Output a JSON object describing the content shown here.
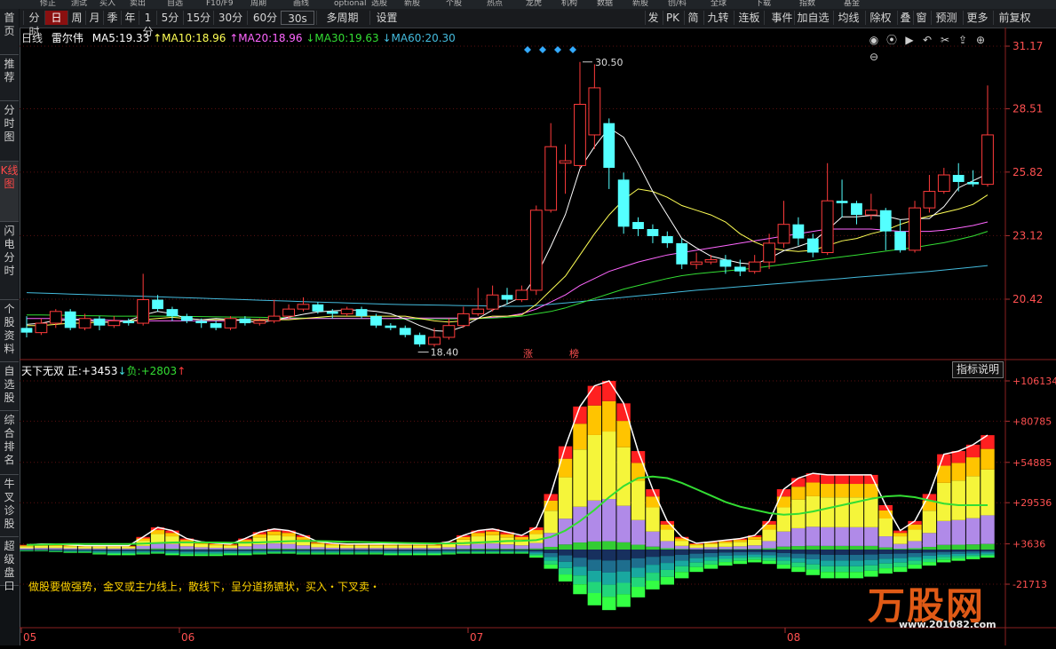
{
  "topstrip": {
    "tabs": [
      "修正",
      "测试",
      "买入",
      "卖出",
      "自选",
      "F10/F9",
      "周期",
      "画线",
      "optional",
      "选股",
      "新股",
      "个股",
      "热点",
      "龙虎",
      "机构",
      "数据",
      "新股",
      "创/科",
      "全球",
      "下载",
      "指数",
      "基金"
    ]
  },
  "leftnav": {
    "items": [
      "首页",
      "推荐",
      "分时图",
      "K线图",
      "闪电分时",
      "个股资料",
      "自选股",
      "综合排名",
      "牛叉诊股",
      "超级盘口"
    ]
  },
  "toolbar": {
    "left": [
      "分时",
      "日",
      "周",
      "月",
      "季",
      "年",
      "1分",
      "5分",
      "15分",
      "30分",
      "60分",
      "30s",
      "多周期",
      "设置"
    ],
    "right": [
      "发",
      "PK",
      "简",
      "九转",
      "连板",
      "事件",
      "加自选",
      "均线",
      "除权",
      "叠",
      "窗",
      "预测",
      "更多",
      "前复权"
    ]
  },
  "info": {
    "period": "日线",
    "stock": "雷尔伟",
    "ma5_label": "MA5:",
    "ma5": "19.33",
    "ma10_label": "↑MA10:",
    "ma10": "18.96",
    "ma20_label": "↑MA20:",
    "ma20": "18.96",
    "ma30_label": "↓MA30:",
    "ma30": "19.63",
    "ma60_label": "↓MA60:",
    "ma60": "20.30"
  },
  "indicator": {
    "name": "天下无双",
    "pos_label": "正:",
    "pos": "+3453",
    "neg_label": "负:",
    "neg": "+2803",
    "explain_button": "指标说明",
    "description": "做股要做强势，金叉或主力线上，散线下，呈分道扬镳状，买入・下叉卖・"
  },
  "price_axis": [
    "31.17",
    "28.51",
    "25.82",
    "23.12",
    "20.42"
  ],
  "indicator_axis": [
    "+106134",
    "+80785",
    "+54885",
    "+29536",
    "+3636",
    "-21713"
  ],
  "x_axis": [
    "05",
    "06",
    "07",
    "08"
  ],
  "annotations": {
    "high": "30.50",
    "low": "18.40",
    "tag1": "涨",
    "tag2": "榜"
  },
  "watermark": {
    "brand": "万股网",
    "url": "www.201082.com"
  },
  "colors": {
    "up": "#ff3b3b",
    "down": "#54ffff",
    "ma5": "#ffffff",
    "ma10": "#ffff55",
    "ma20": "#ff66ff",
    "ma30": "#33dd33",
    "ma60": "#44bbdd"
  },
  "chart_data": {
    "type": "candlestick",
    "candles": [
      [
        19.2,
        19.0,
        19.7,
        18.8
      ],
      [
        19.0,
        19.4,
        19.6,
        18.9
      ],
      [
        19.4,
        19.9,
        20.0,
        19.2
      ],
      [
        19.9,
        19.2,
        20.0,
        19.1
      ],
      [
        19.2,
        19.6,
        19.8,
        19.1
      ],
      [
        19.6,
        19.3,
        19.7,
        19.1
      ],
      [
        19.3,
        19.5,
        19.7,
        19.2
      ],
      [
        19.5,
        19.4,
        19.6,
        19.3
      ],
      [
        19.4,
        20.4,
        21.5,
        19.3
      ],
      [
        20.4,
        20.0,
        20.6,
        19.9
      ],
      [
        20.0,
        19.7,
        20.1,
        19.5
      ],
      [
        19.7,
        19.5,
        19.8,
        19.4
      ],
      [
        19.5,
        19.4,
        19.6,
        19.2
      ],
      [
        19.4,
        19.2,
        19.5,
        19.1
      ],
      [
        19.2,
        19.6,
        19.7,
        19.1
      ],
      [
        19.6,
        19.4,
        19.7,
        19.3
      ],
      [
        19.4,
        19.5,
        19.6,
        19.3
      ],
      [
        19.5,
        19.7,
        20.4,
        19.4
      ],
      [
        19.7,
        20.0,
        20.2,
        19.6
      ],
      [
        20.0,
        20.2,
        20.5,
        19.9
      ],
      [
        20.2,
        19.9,
        20.3,
        19.8
      ],
      [
        19.9,
        19.8,
        20.0,
        19.6
      ],
      [
        19.8,
        20.0,
        20.1,
        19.7
      ],
      [
        20.0,
        19.7,
        20.1,
        19.6
      ],
      [
        19.7,
        19.3,
        19.8,
        19.2
      ],
      [
        19.3,
        19.2,
        19.4,
        19.1
      ],
      [
        19.2,
        18.9,
        19.3,
        18.8
      ],
      [
        18.9,
        18.5,
        19.0,
        18.4
      ],
      [
        18.5,
        18.8,
        19.2,
        18.4
      ],
      [
        18.8,
        19.3,
        19.6,
        18.7
      ],
      [
        19.3,
        19.8,
        20.1,
        19.2
      ],
      [
        19.8,
        20.0,
        20.9,
        19.7
      ],
      [
        20.0,
        20.6,
        21.0,
        19.9
      ],
      [
        20.6,
        20.4,
        20.9,
        20.2
      ],
      [
        20.4,
        20.8,
        21.0,
        20.3
      ],
      [
        20.8,
        24.2,
        24.4,
        20.6
      ],
      [
        24.2,
        26.9,
        27.9,
        24.1
      ],
      [
        26.2,
        26.3,
        27.0,
        24.9
      ],
      [
        26.1,
        28.7,
        30.5,
        26.0
      ],
      [
        27.4,
        29.4,
        30.4,
        26.8
      ],
      [
        27.9,
        26.0,
        28.1,
        25.1
      ],
      [
        25.5,
        23.5,
        25.8,
        23.2
      ],
      [
        23.7,
        23.4,
        23.9,
        23.1
      ],
      [
        23.4,
        23.1,
        23.6,
        22.8
      ],
      [
        23.1,
        22.8,
        23.3,
        22.6
      ],
      [
        22.8,
        21.9,
        23.0,
        21.7
      ],
      [
        21.9,
        22.0,
        22.4,
        21.7
      ],
      [
        22.0,
        22.1,
        22.3,
        21.9
      ],
      [
        22.1,
        21.8,
        22.3,
        21.5
      ],
      [
        21.8,
        21.6,
        22.1,
        21.4
      ],
      [
        21.6,
        22.0,
        22.3,
        21.5
      ],
      [
        22.0,
        22.8,
        23.2,
        21.7
      ],
      [
        22.8,
        23.6,
        24.6,
        22.6
      ],
      [
        23.6,
        23.0,
        23.9,
        22.7
      ],
      [
        23.0,
        22.4,
        23.2,
        22.2
      ],
      [
        22.4,
        24.6,
        26.2,
        22.3
      ],
      [
        24.6,
        24.5,
        25.5,
        23.9
      ],
      [
        24.5,
        24.0,
        24.6,
        23.6
      ],
      [
        24.0,
        24.2,
        24.9,
        23.8
      ],
      [
        24.2,
        23.3,
        24.3,
        22.5
      ],
      [
        23.3,
        22.5,
        23.8,
        22.4
      ],
      [
        22.5,
        24.3,
        24.6,
        22.4
      ],
      [
        24.3,
        25.0,
        25.7,
        24.1
      ],
      [
        25.0,
        25.7,
        26.0,
        24.9
      ],
      [
        25.7,
        25.4,
        26.2,
        25.0
      ],
      [
        25.4,
        25.3,
        25.9,
        25.2
      ],
      [
        25.3,
        27.4,
        29.5,
        25.2
      ]
    ],
    "ma5": [
      19.35,
      19.4,
      19.52,
      19.54,
      19.55,
      19.45,
      19.45,
      19.5,
      19.75,
      19.9,
      19.8,
      19.6,
      19.55,
      19.6,
      19.56,
      19.5,
      19.42,
      19.53,
      19.66,
      19.78,
      19.88,
      19.92,
      19.96,
      19.96,
      19.9,
      19.8,
      19.58,
      19.3,
      19.08,
      19.05,
      19.26,
      19.6,
      19.96,
      20.22,
      20.52,
      21.4,
      22.66,
      24.02,
      25.96,
      26.9,
      27.7,
      27.3,
      26.2,
      25.0,
      24.0,
      23.0,
      22.6,
      22.25,
      22.1,
      21.96,
      21.9,
      22.16,
      22.48,
      22.66,
      22.88,
      23.36,
      23.92,
      23.92,
      23.98,
      23.95,
      23.8,
      23.85,
      23.85,
      24.35,
      25.15,
      25.45,
      25.75
    ],
    "ma10": [
      19.3,
      19.3,
      19.35,
      19.4,
      19.4,
      19.45,
      19.45,
      19.5,
      19.55,
      19.6,
      19.65,
      19.6,
      19.55,
      19.55,
      19.55,
      19.55,
      19.55,
      19.55,
      19.55,
      19.6,
      19.65,
      19.7,
      19.7,
      19.7,
      19.7,
      19.7,
      19.7,
      19.6,
      19.5,
      19.45,
      19.5,
      19.6,
      19.7,
      19.7,
      19.75,
      20.2,
      20.8,
      21.4,
      22.3,
      23.2,
      24.0,
      24.65,
      25.1,
      25.0,
      24.75,
      24.4,
      24.2,
      24.0,
      23.7,
      23.2,
      22.85,
      22.6,
      22.5,
      22.45,
      22.5,
      22.7,
      22.9,
      23.0,
      23.2,
      23.35,
      23.6,
      23.8,
      23.95,
      24.1,
      24.25,
      24.45,
      24.85
    ],
    "ma20": [
      19.6,
      19.6,
      19.6,
      19.58,
      19.56,
      19.54,
      19.52,
      19.5,
      19.5,
      19.5,
      19.5,
      19.5,
      19.5,
      19.5,
      19.5,
      19.55,
      19.55,
      19.55,
      19.6,
      19.6,
      19.6,
      19.6,
      19.6,
      19.6,
      19.6,
      19.6,
      19.62,
      19.62,
      19.62,
      19.62,
      19.62,
      19.62,
      19.65,
      19.7,
      19.8,
      20.0,
      20.3,
      20.6,
      21.0,
      21.3,
      21.6,
      21.8,
      22.0,
      22.15,
      22.3,
      22.4,
      22.5,
      22.6,
      22.7,
      22.8,
      22.9,
      23.0,
      23.1,
      23.2,
      23.3,
      23.4,
      23.4,
      23.4,
      23.4,
      23.35,
      23.3,
      23.3,
      23.3,
      23.35,
      23.45,
      23.55,
      23.7
    ],
    "ma30": [
      19.75,
      19.75,
      19.74,
      19.73,
      19.72,
      19.71,
      19.7,
      19.7,
      19.7,
      19.7,
      19.7,
      19.69,
      19.68,
      19.67,
      19.66,
      19.66,
      19.65,
      19.64,
      19.63,
      19.62,
      19.62,
      19.61,
      19.61,
      19.6,
      19.6,
      19.59,
      19.58,
      19.58,
      19.58,
      19.58,
      19.59,
      19.6,
      19.62,
      19.65,
      19.7,
      19.8,
      19.9,
      20.05,
      20.25,
      20.45,
      20.65,
      20.85,
      21.0,
      21.15,
      21.3,
      21.42,
      21.5,
      21.56,
      21.62,
      21.68,
      21.74,
      21.82,
      21.9,
      21.98,
      22.06,
      22.14,
      22.22,
      22.3,
      22.38,
      22.46,
      22.54,
      22.62,
      22.72,
      22.82,
      22.96,
      23.1,
      23.3
    ],
    "ma60": [
      20.7,
      20.68,
      20.66,
      20.64,
      20.62,
      20.6,
      20.58,
      20.56,
      20.54,
      20.52,
      20.5,
      20.48,
      20.46,
      20.44,
      20.42,
      20.4,
      20.38,
      20.36,
      20.34,
      20.32,
      20.3,
      20.28,
      20.26,
      20.24,
      20.22,
      20.2,
      20.19,
      20.18,
      20.17,
      20.16,
      20.15,
      20.14,
      20.13,
      20.12,
      20.12,
      20.15,
      20.2,
      20.26,
      20.32,
      20.38,
      20.44,
      20.5,
      20.56,
      20.62,
      20.68,
      20.74,
      20.8,
      20.85,
      20.9,
      20.95,
      21.0,
      21.05,
      21.1,
      21.15,
      21.2,
      21.25,
      21.3,
      21.35,
      21.4,
      21.45,
      21.5,
      21.55,
      21.6,
      21.66,
      21.72,
      21.78,
      21.85
    ],
    "indicator_pos": [
      3000,
      3500,
      3500,
      3000,
      2500,
      2500,
      2500,
      2500,
      8000,
      14000,
      12000,
      7000,
      5000,
      4000,
      3500,
      7000,
      11000,
      13000,
      12000,
      9000,
      5000,
      4000,
      3500,
      3500,
      3500,
      3500,
      3500,
      3500,
      3500,
      5000,
      9000,
      12000,
      13000,
      11000,
      9000,
      14000,
      35000,
      65000,
      90000,
      103000,
      106134,
      92000,
      62000,
      38000,
      18000,
      8000,
      4000,
      5000,
      6000,
      7000,
      9000,
      18000,
      38000,
      45000,
      48000,
      47000,
      47000,
      47000,
      47000,
      28000,
      12000,
      18000,
      35000,
      60000,
      62000,
      66000,
      72000
    ],
    "indicator_neg": [
      -1000,
      -1000,
      -1500,
      -2000,
      -2000,
      -3000,
      -3500,
      -3500,
      -3000,
      -2500,
      -3500,
      -4000,
      -4000,
      -4000,
      -3500,
      -3500,
      -3000,
      -2500,
      -2500,
      -3000,
      -3000,
      -3000,
      -3000,
      -3000,
      -3000,
      -3500,
      -3500,
      -3500,
      -3500,
      -3000,
      -2500,
      -2500,
      -2500,
      -2500,
      -2500,
      -5000,
      -12000,
      -20000,
      -28000,
      -35000,
      -38000,
      -36000,
      -30000,
      -25000,
      -22000,
      -18000,
      -14000,
      -12000,
      -10000,
      -9000,
      -8000,
      -9000,
      -12000,
      -14000,
      -16000,
      -18000,
      -18000,
      -18000,
      -17000,
      -15000,
      -14000,
      -12000,
      -10000,
      -8000,
      -7000,
      -6000,
      -5000
    ],
    "indicator_line": [
      3000,
      3200,
      3400,
      3500,
      3500,
      3500,
      3500,
      3500,
      3800,
      4200,
      4500,
      4600,
      4600,
      4500,
      4400,
      4400,
      4600,
      5000,
      5300,
      5500,
      5400,
      5200,
      5000,
      4800,
      4600,
      4400,
      4200,
      4000,
      3900,
      3900,
      4100,
      4500,
      5000,
      5400,
      5600,
      6000,
      8000,
      12000,
      18000,
      25000,
      33000,
      40000,
      45000,
      46000,
      45000,
      42000,
      38000,
      34000,
      30000,
      27000,
      25000,
      23000,
      22000,
      22500,
      24000,
      26000,
      28000,
      30000,
      32000,
      33500,
      34000,
      33000,
      31000,
      29000,
      28000,
      28000,
      28000
    ]
  }
}
